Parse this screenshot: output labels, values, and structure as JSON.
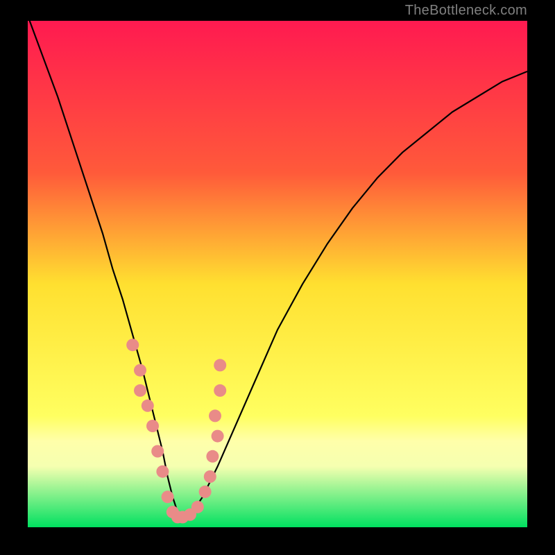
{
  "watermark": "TheBottleneck.com",
  "colors": {
    "gradient_top": "#ff1a50",
    "gradient_mid_upper": "#ff7a2a",
    "gradient_mid": "#ffe030",
    "gradient_band_pale": "#ffffaa",
    "gradient_bottom": "#00e060",
    "curve": "#000000",
    "dots": "#e98b88",
    "frame": "#000000"
  },
  "chart_data": {
    "type": "line",
    "title": "",
    "xlabel": "",
    "ylabel": "",
    "xlim": [
      0,
      100
    ],
    "ylim": [
      0,
      100
    ],
    "curve": {
      "x": [
        0,
        3,
        6,
        9,
        12,
        15,
        17,
        19,
        21,
        23,
        25,
        27,
        28,
        29,
        30,
        31,
        32,
        33,
        35,
        38,
        42,
        46,
        50,
        55,
        60,
        65,
        70,
        75,
        80,
        85,
        90,
        95,
        100
      ],
      "y": [
        101,
        93,
        85,
        76,
        67,
        58,
        51,
        45,
        38,
        31,
        23,
        15,
        10,
        6,
        3,
        2,
        2,
        3,
        6,
        12,
        21,
        30,
        39,
        48,
        56,
        63,
        69,
        74,
        78,
        82,
        85,
        88,
        90
      ]
    },
    "dots": {
      "x": [
        21.0,
        22.5,
        22.5,
        24.0,
        25.0,
        26.0,
        27.0,
        28.0,
        29.0,
        30.0,
        31.0,
        32.5,
        34.0,
        35.5,
        36.5,
        37.0,
        38.0,
        37.5,
        38.5,
        38.5
      ],
      "y": [
        36.0,
        31.0,
        27.0,
        24.0,
        20.0,
        15.0,
        11.0,
        6.0,
        3.0,
        2.0,
        2.0,
        2.5,
        4.0,
        7.0,
        10.0,
        14.0,
        18.0,
        22.0,
        27.0,
        32.0
      ]
    }
  }
}
